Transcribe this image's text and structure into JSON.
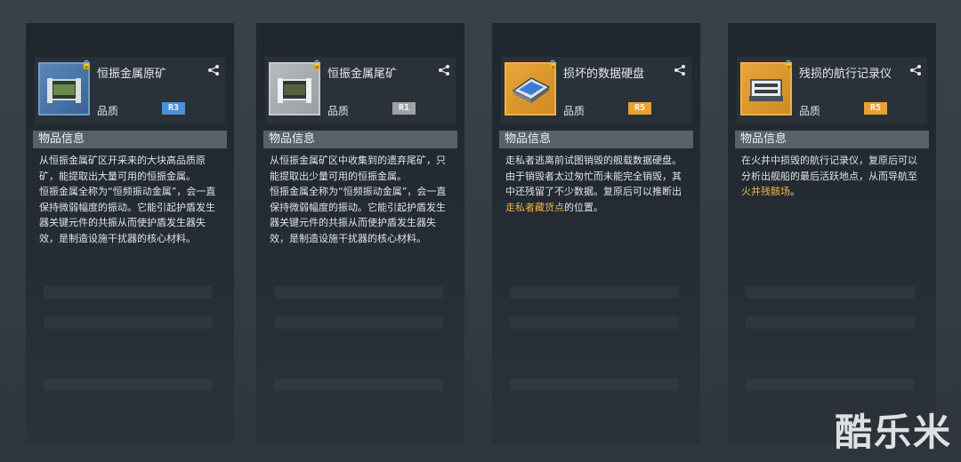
{
  "colors": {
    "r1": "#9ea2a6",
    "r3": "#4d8fd6",
    "r5": "#e9a035",
    "highlight": "#f0b34a"
  },
  "common": {
    "quality_label": "品质",
    "section_title": "物品信息"
  },
  "cards": [
    {
      "name": "恒振金属原矿",
      "rarity": "R3",
      "desc": "从恒振金属矿区开采来的大块高品质原矿，能提取出大量可用的恒振金属。\n恒振金属全称为“恒频振动金属”，会一直保持微弱幅度的振动。它能引起护盾发生器关键元件的共振从而使护盾发生器失效，是制造设施干扰器的核心材料。",
      "desc_highlight": "",
      "desc_tail": ""
    },
    {
      "name": "恒振金属尾矿",
      "rarity": "R1",
      "desc": "从恒振金属矿区中收集到的遗弃尾矿，只能提取出少量可用的恒振金属。\n恒振金属全称为“恒频振动金属”，会一直保持微弱幅度的振动。它能引起护盾发生器关键元件的共振从而使护盾发生器失效，是制造设施干扰器的核心材料。",
      "desc_highlight": "",
      "desc_tail": ""
    },
    {
      "name": "损坏的数据硬盘",
      "rarity": "R5",
      "desc": "走私者逃离前试图销毁的舰载数据硬盘。由于销毁者太过匆忙而未能完全销毁，其中还残留了不少数据。复原后可以推断出",
      "desc_highlight": "走私者藏货点",
      "desc_tail": "的位置。"
    },
    {
      "name": "残损的航行记录仪",
      "rarity": "R5",
      "desc": "在火井中损毁的航行记录仪，复原后可以分析出舰船的最后活跃地点，从而导航至",
      "desc_highlight": "火井残骸场",
      "desc_tail": "。"
    }
  ],
  "watermark": "酷乐米"
}
